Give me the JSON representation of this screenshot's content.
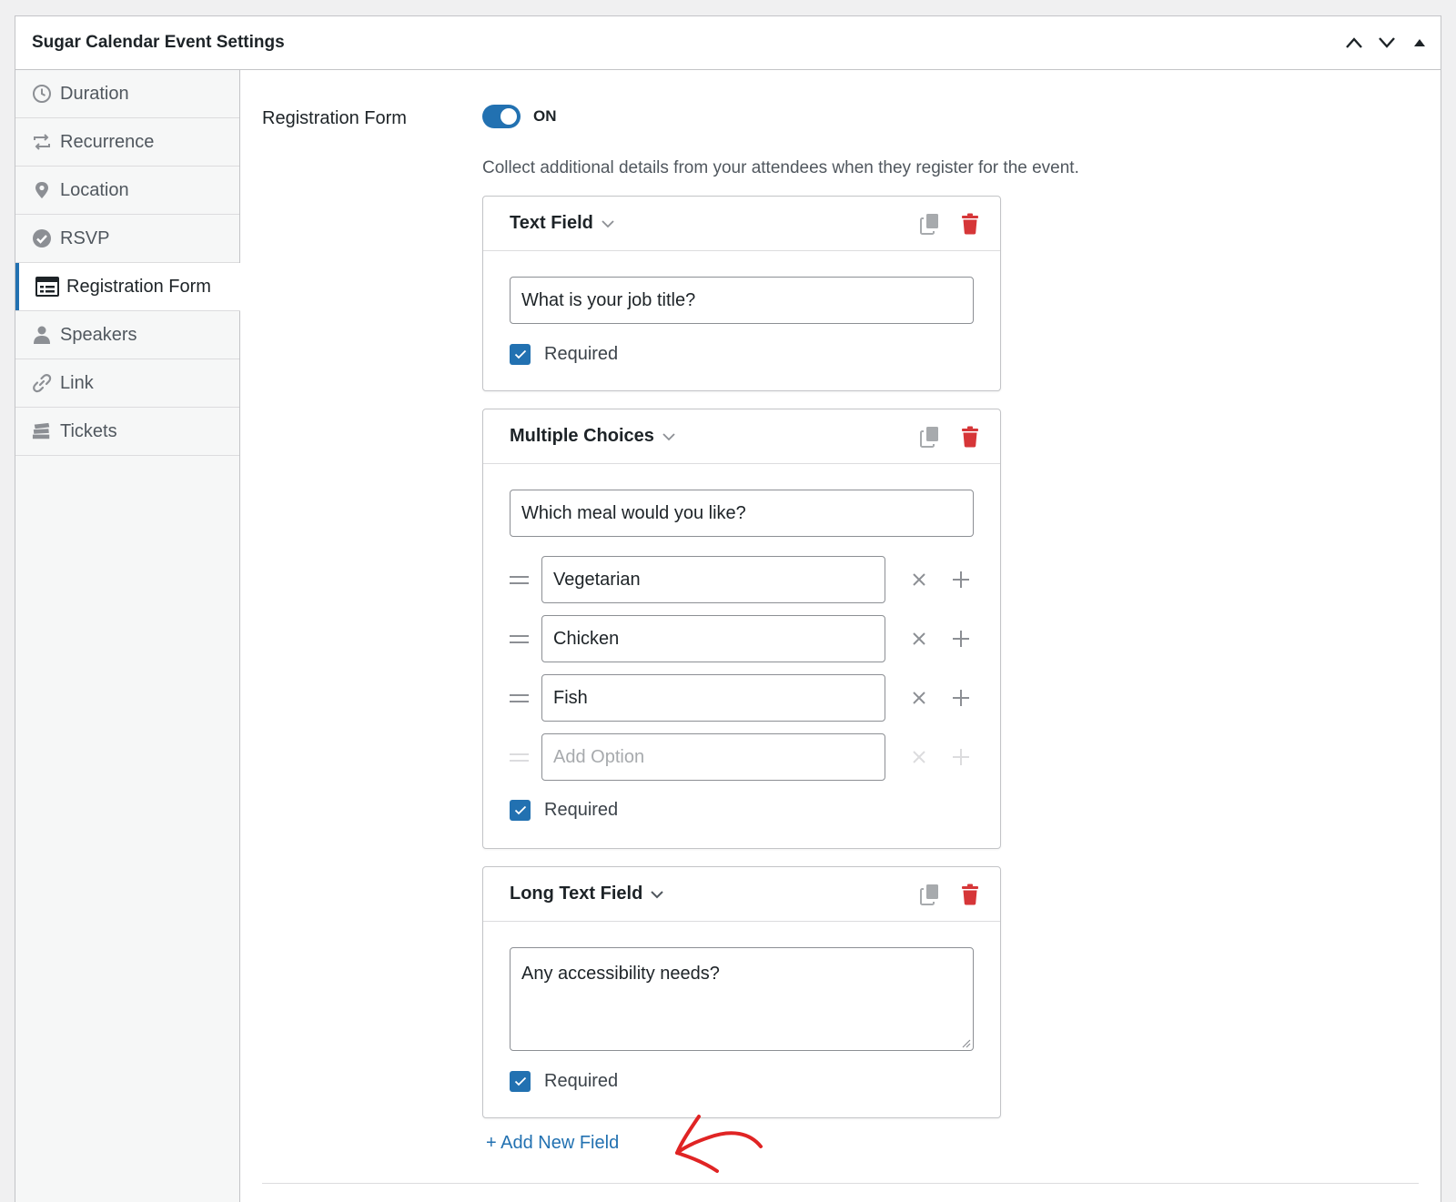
{
  "metabox": {
    "title": "Sugar Calendar Event Settings"
  },
  "sidebar": {
    "items": [
      {
        "label": "Duration",
        "icon": "clock-icon"
      },
      {
        "label": "Recurrence",
        "icon": "repeat-icon"
      },
      {
        "label": "Location",
        "icon": "location-pin-icon"
      },
      {
        "label": "RSVP",
        "icon": "check-circle-icon"
      },
      {
        "label": "Registration Form",
        "icon": "form-icon",
        "active": true
      },
      {
        "label": "Speakers",
        "icon": "person-icon"
      },
      {
        "label": "Link",
        "icon": "link-icon"
      },
      {
        "label": "Tickets",
        "icon": "tickets-icon"
      }
    ]
  },
  "registration": {
    "label": "Registration Form",
    "toggle_state": "ON",
    "toggle_on": true,
    "description": "Collect additional details from your attendees when they register for the event."
  },
  "fields": [
    {
      "type_label": "Text Field",
      "question": "What is your job title?",
      "required_label": "Required",
      "required": true
    },
    {
      "type_label": "Multiple Choices",
      "question": "Which meal would you like?",
      "options": [
        "Vegetarian",
        "Chicken",
        "Fish"
      ],
      "add_option_placeholder": "Add Option",
      "required_label": "Required",
      "required": true
    },
    {
      "type_label": "Long Text Field",
      "question": "Any accessibility needs?",
      "required_label": "Required",
      "required": true
    }
  ],
  "add_field_label": "+ Add New Field",
  "colors": {
    "accent": "#2271b1",
    "delete": "#d63638",
    "annotation_arrow": "#e02424"
  }
}
